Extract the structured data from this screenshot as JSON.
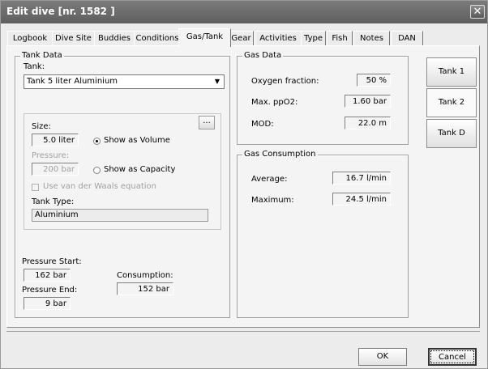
{
  "window": {
    "title": "Edit dive [nr. 1582 ]",
    "close_symbol": "✕"
  },
  "tabs": [
    {
      "label": "Logbook"
    },
    {
      "label": "Dive Site"
    },
    {
      "label": "Buddies"
    },
    {
      "label": "Conditions"
    },
    {
      "label": "Gas/Tank",
      "active": true
    },
    {
      "label": "Gear"
    },
    {
      "label": "Activities"
    },
    {
      "label": "Type"
    },
    {
      "label": "Fish"
    },
    {
      "label": "Notes"
    },
    {
      "label": "DAN"
    }
  ],
  "tank_data": {
    "title": "Tank Data",
    "tank_label": "Tank:",
    "tank_value": "Tank  5 liter Aluminium",
    "size_label": "Size:",
    "size_value": "5.0 liter",
    "browse_label": "...",
    "show_volume_label": "Show as Volume",
    "pressure_label": "Pressure:",
    "pressure_value": "200 bar",
    "show_capacity_label": "Show as Capacity",
    "van_der_waals_label": "Use van der Waals equation",
    "tank_type_label": "Tank Type:",
    "tank_type_value": "Aluminium",
    "pressure_start_label": "Pressure Start:",
    "pressure_start_value": "162 bar",
    "pressure_end_label": "Pressure End:",
    "pressure_end_value": "9 bar",
    "consumption_label": "Consumption:",
    "consumption_value": "152 bar"
  },
  "gas_data": {
    "title": "Gas Data",
    "oxygen_label": "Oxygen fraction:",
    "oxygen_value": "50 %",
    "ppo2_label": "Max. ppO2:",
    "ppo2_value": "1.60 bar",
    "mod_label": "MOD:",
    "mod_value": "22.0 m"
  },
  "gas_consumption": {
    "title": "Gas Consumption",
    "average_label": "Average:",
    "average_value": "16.7 l/min",
    "maximum_label": "Maximum:",
    "maximum_value": "24.5 l/min"
  },
  "side_buttons": [
    "Tank 1",
    "Tank 2",
    "Tank D"
  ],
  "footer": {
    "ok_label": "OK",
    "cancel_label": "Cancel"
  },
  "colors": {
    "titlebar": "#6b6b6b",
    "panel": "#f4f4f4",
    "window": "#ececec"
  }
}
